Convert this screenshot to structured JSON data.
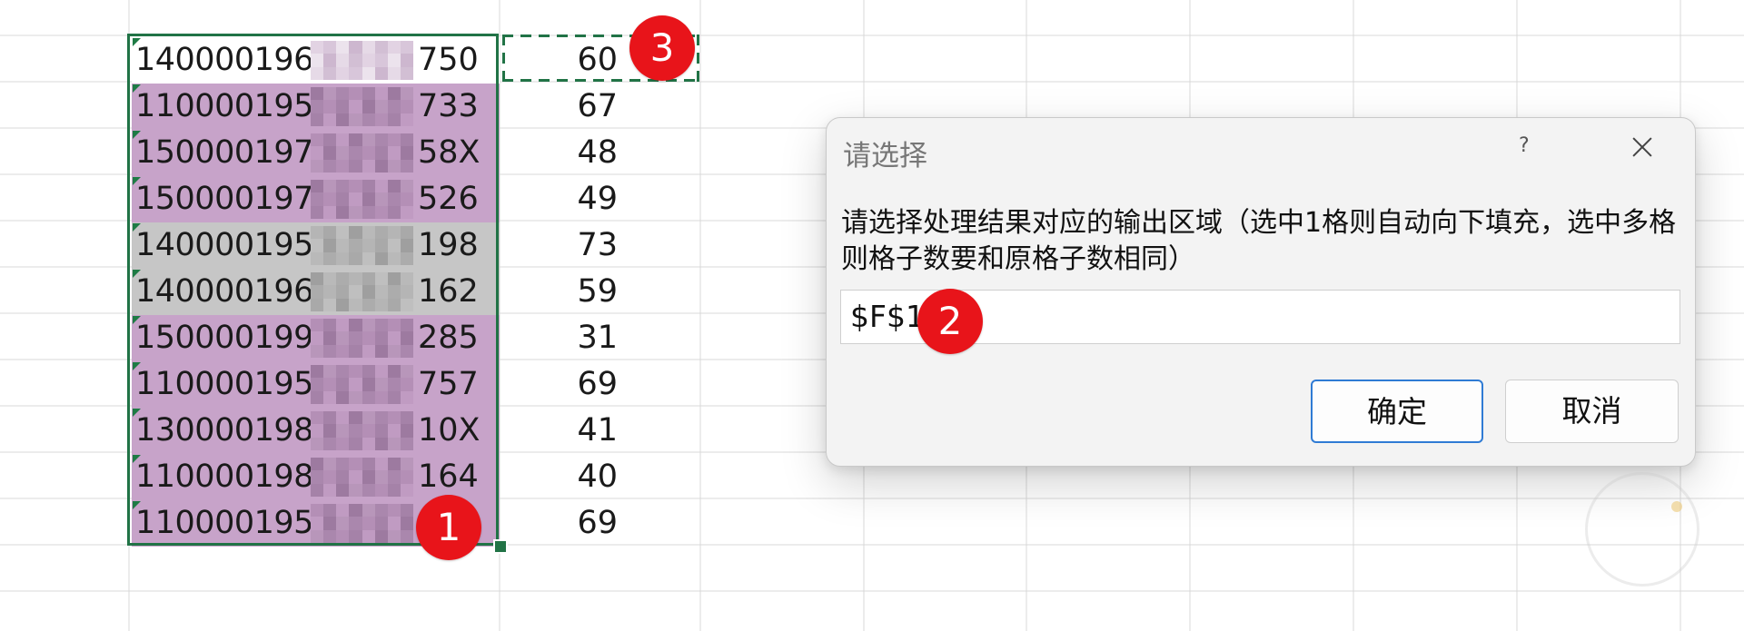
{
  "colors": {
    "selection_border": "#217346",
    "row_purple": "#c7a3c9",
    "row_gray": "#c6c6c6",
    "badge_red": "#e8141a",
    "ok_border": "#2f7bd4"
  },
  "rows": [
    {
      "id_prefix": "1400001964",
      "id_suffix": "750",
      "value": "60",
      "bg": "#ffffff"
    },
    {
      "id_prefix": "1100001957",
      "id_suffix": "733",
      "value": "67",
      "bg": "#c7a3c9"
    },
    {
      "id_prefix": "1500001976",
      "id_suffix": "58X",
      "value": "48",
      "bg": "#c7a3c9"
    },
    {
      "id_prefix": "1500001975",
      "id_suffix": "526",
      "value": "49",
      "bg": "#c7a3c9"
    },
    {
      "id_prefix": "1400001951",
      "id_suffix": "198",
      "value": "73",
      "bg": "#c6c6c6"
    },
    {
      "id_prefix": "1400001964",
      "id_suffix": "162",
      "value": "59",
      "bg": "#c6c6c6"
    },
    {
      "id_prefix": "1500001993",
      "id_suffix": "285",
      "value": "31",
      "bg": "#c7a3c9"
    },
    {
      "id_prefix": "1100001955",
      "id_suffix": "757",
      "value": "69",
      "bg": "#c7a3c9"
    },
    {
      "id_prefix": "1300001982",
      "id_suffix": "10X",
      "value": "41",
      "bg": "#c7a3c9"
    },
    {
      "id_prefix": "1100001984",
      "id_suffix": "164",
      "value": "40",
      "bg": "#c7a3c9"
    },
    {
      "id_prefix": "1100001955",
      "id_suffix": "",
      "value": "69",
      "bg": "#c7a3c9"
    }
  ],
  "badges": {
    "one": "1",
    "two": "2",
    "three": "3"
  },
  "dialog": {
    "title": "请选择",
    "help_label": "?",
    "message": "请选择处理结果对应的输出区域（选中1格则自动向下填充，选中多格则格子数要和原格子数相同）",
    "input_value": "$F$1",
    "ok_label": "确定",
    "cancel_label": "取消"
  }
}
